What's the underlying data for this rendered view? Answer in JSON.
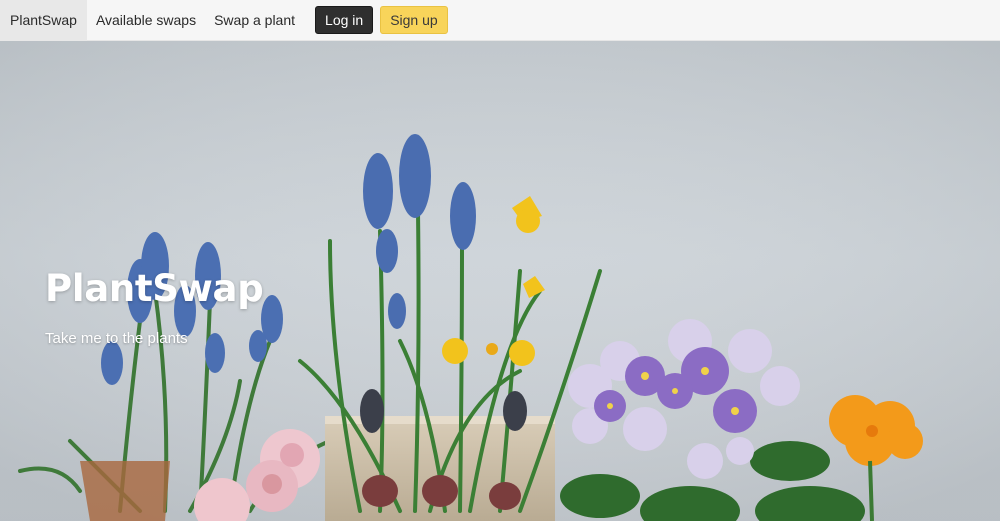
{
  "nav": {
    "brand": "PlantSwap",
    "links": [
      "Available swaps",
      "Swap a plant"
    ],
    "login_label": "Log in",
    "signup_label": "Sign up"
  },
  "hero": {
    "title": "PlantSwap",
    "subtitle": "Take me to the plants"
  },
  "colors": {
    "login_button": "#2f2f2f",
    "signup_button": "#f8d45a",
    "navbar_background": "#f6f6f6"
  }
}
